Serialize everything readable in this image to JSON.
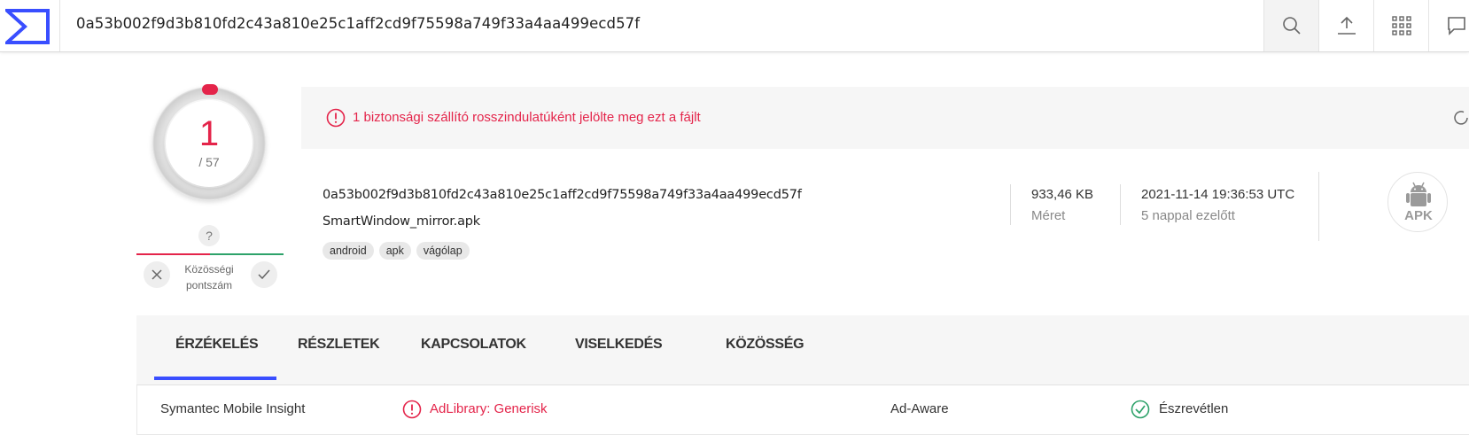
{
  "topbar": {
    "search_value": "0a53b002f9d3b810fd2c43a810e25c1aff2cd9f75598a749f33a4aa499ecd57f"
  },
  "score": {
    "detections": "1",
    "total": "/ 57"
  },
  "community": {
    "unknown_mark": "?",
    "label_line1": "Közösségi",
    "label_line2": "pontszám"
  },
  "alert": {
    "text": "1 biztonsági szállító rosszindulatúként jelölte meg ezt a fájlt"
  },
  "file": {
    "hash": "0a53b002f9d3b810fd2c43a810e25c1aff2cd9f75598a749f33a4aa499ecd57f",
    "name": "SmartWindow_mirror.apk",
    "tags": [
      "android",
      "apk",
      "vágólap"
    ],
    "size_value": "933,46 KB",
    "size_label": "Méret",
    "date_value": "2021-11-14 19:36:53 UTC",
    "date_label": "5 nappal ezelőtt",
    "type_badge": "APK"
  },
  "tabs": [
    "ÉRZÉKELÉS",
    "RÉSZLETEK",
    "KAPCSOLATOK",
    "VISELKEDÉS",
    "KÖZÖSSÉG"
  ],
  "detections_row": {
    "vendor1": "Symantec Mobile Insight",
    "result1": "AdLibrary: Generisk",
    "vendor2": "Ad-Aware",
    "result2": "Észrevétlen"
  },
  "colors": {
    "malicious": "#e4244a",
    "clean": "#2ea26a",
    "accent": "#394eff"
  }
}
